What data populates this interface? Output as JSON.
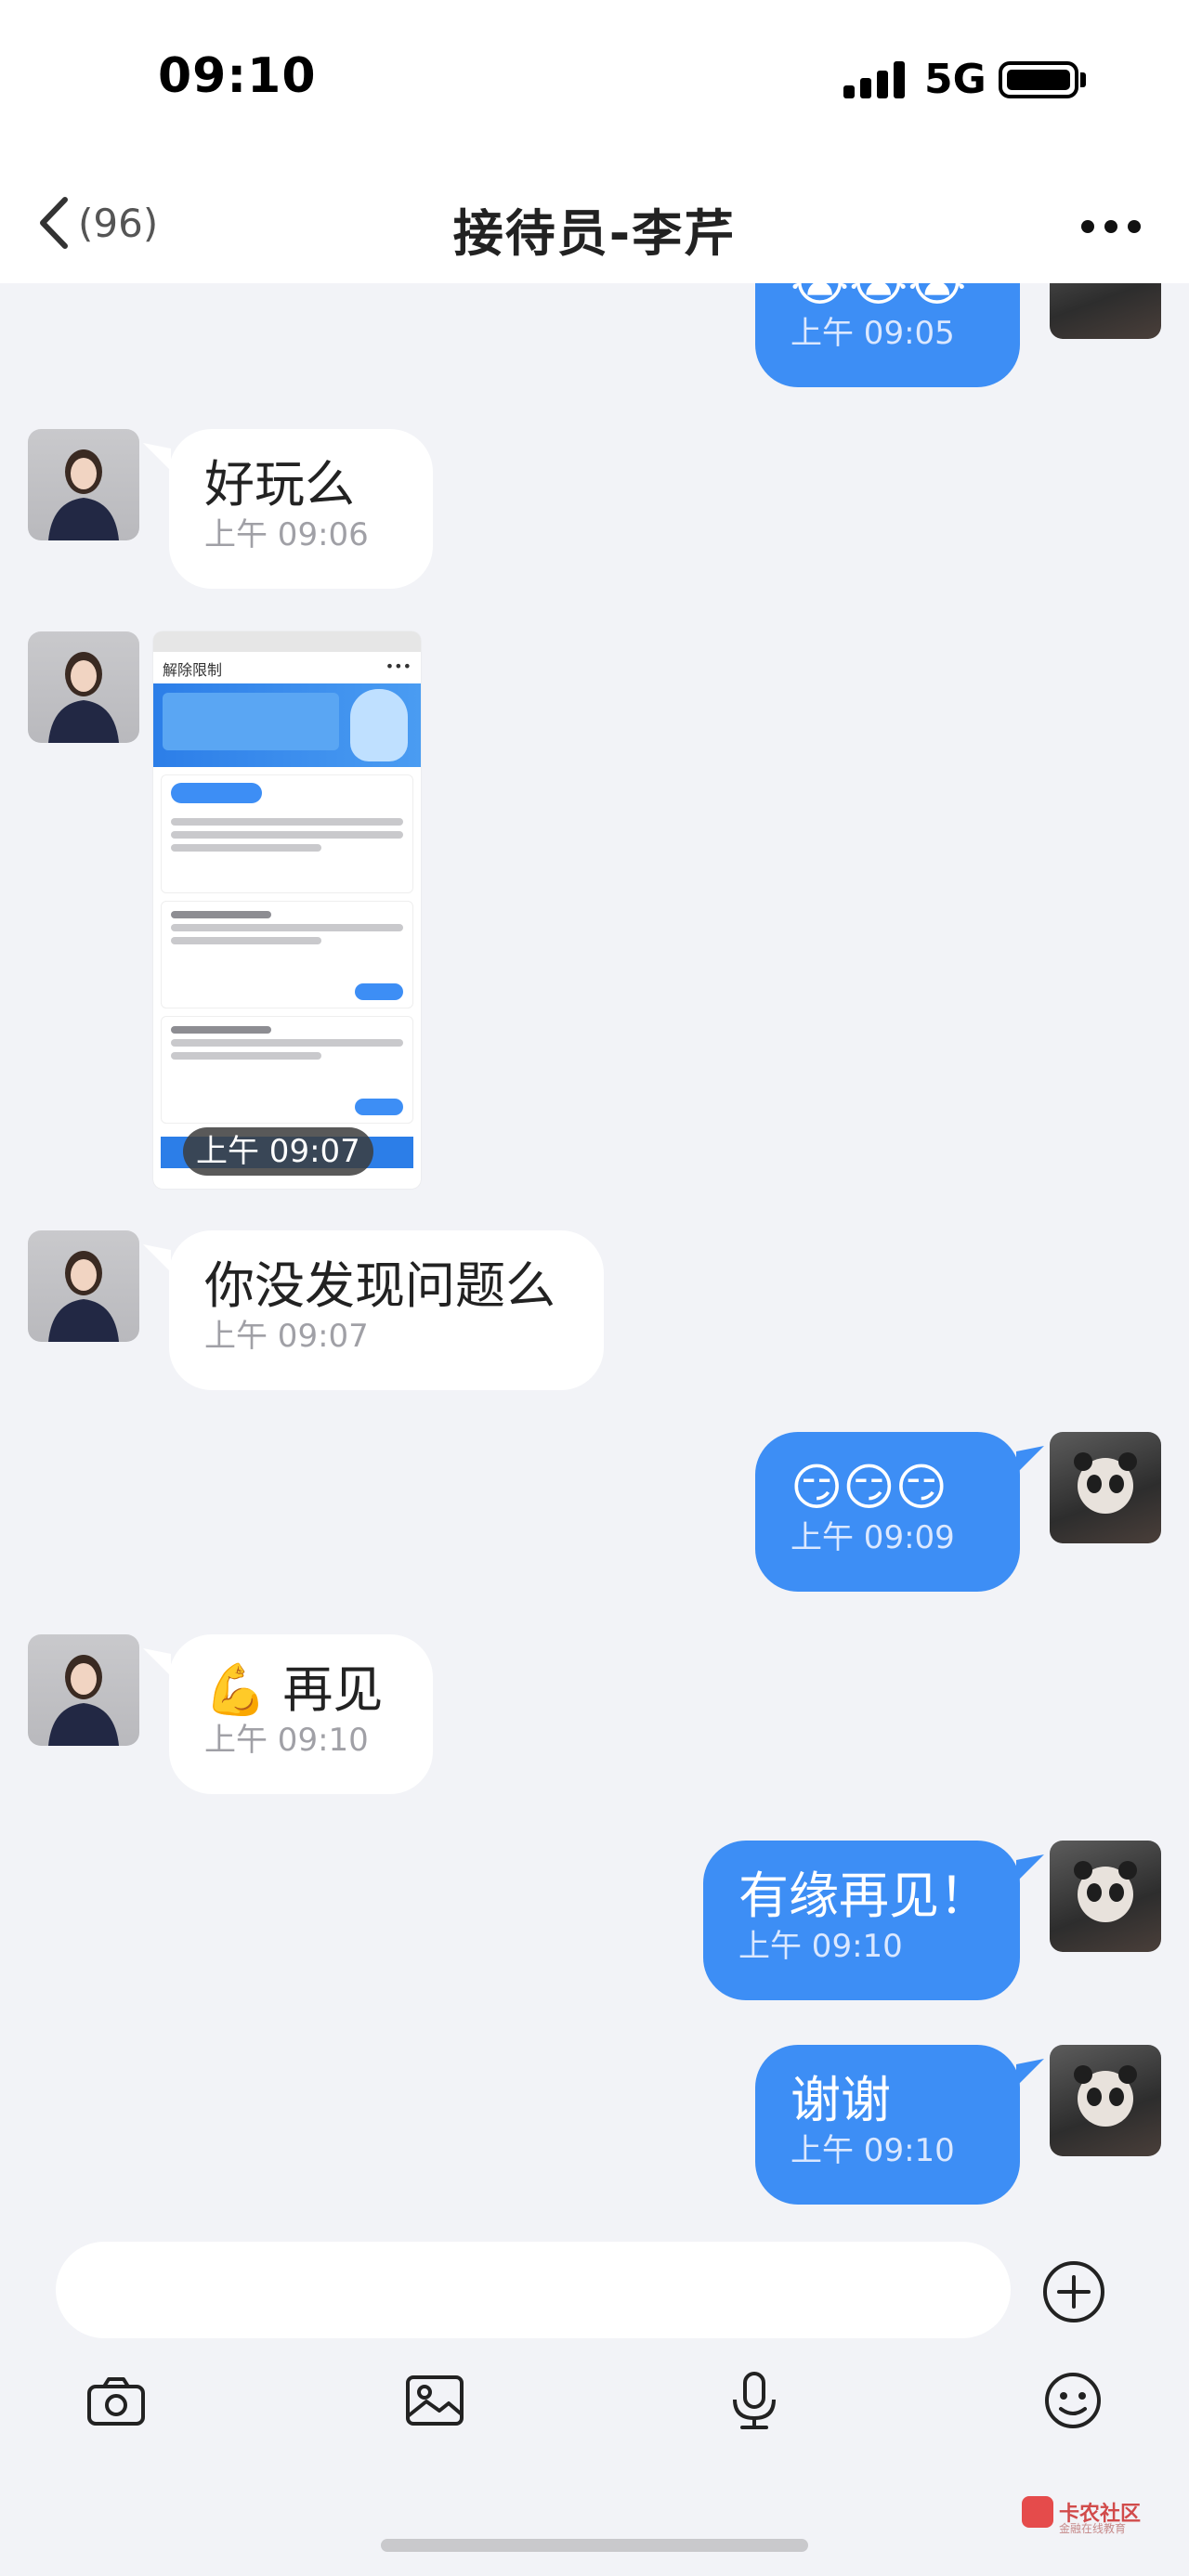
{
  "status_bar": {
    "time": "09:10",
    "network": "5G"
  },
  "nav": {
    "back_count": "(96)",
    "title": "接待员-李芹"
  },
  "messages": [
    {
      "side": "out",
      "text": "😭😭😭",
      "time": "上午 09:05"
    },
    {
      "side": "in",
      "text": "好玩么",
      "time": "上午 09:06"
    },
    {
      "side": "in",
      "type": "image",
      "time": "上午 09:07"
    },
    {
      "side": "in",
      "text": "你没发现问题么",
      "time": "上午 09:07"
    },
    {
      "side": "out",
      "text": "😏😏😏",
      "time": "上午 09:09"
    },
    {
      "side": "in",
      "text": "💪 再见",
      "time": "上午 09:10"
    },
    {
      "side": "out",
      "text": "有缘再见！",
      "time": "上午 09:10"
    },
    {
      "side": "out",
      "text": "谢谢",
      "time": "上午 09:10"
    }
  ],
  "screenshot_image": {
    "nav_title": "解除限制"
  },
  "input": {
    "placeholder": ""
  },
  "toolbar": [
    "camera-icon",
    "image-icon",
    "microphone-icon",
    "emoji-icon"
  ],
  "watermark": {
    "text": "卡农社区",
    "sub": "金融在线教育"
  },
  "colors": {
    "outgoing_bubble": "#3d8ef5",
    "incoming_bubble": "#ffffff",
    "background": "#f2f3f7"
  }
}
